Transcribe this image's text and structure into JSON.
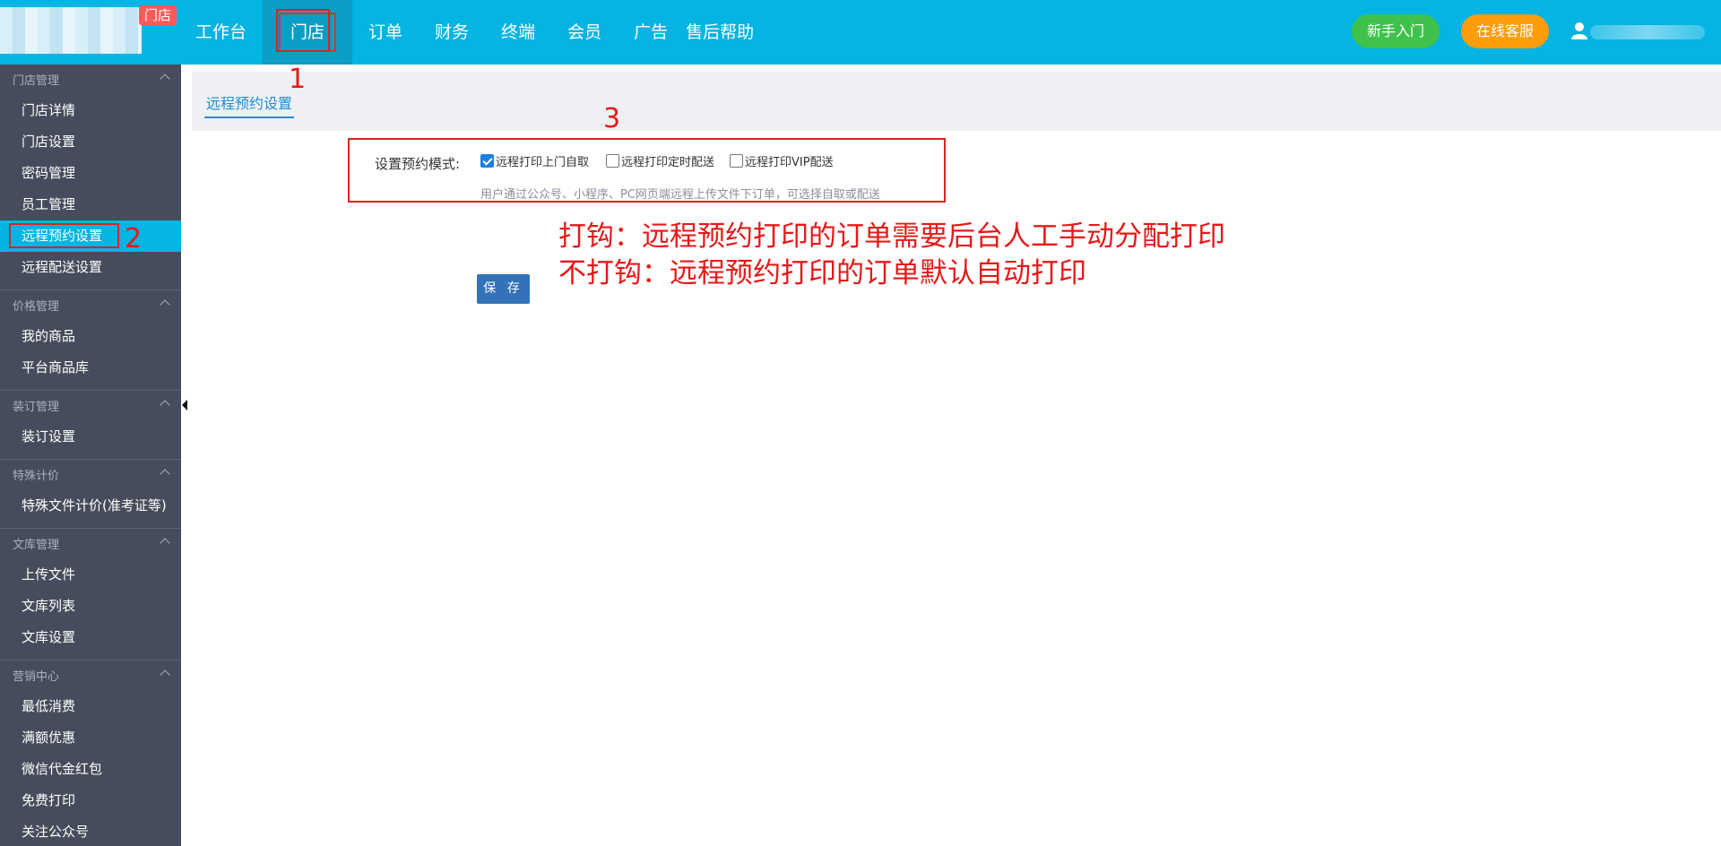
{
  "header": {
    "logo_badge": "门店",
    "nav": [
      "工作台",
      "门店",
      "订单",
      "财务",
      "终端",
      "会员",
      "广告",
      "售后帮助"
    ],
    "active_nav_index": 1,
    "new_user_button": "新手入门",
    "service_button": "在线客服",
    "user_icon": "user-icon"
  },
  "sidebar": {
    "groups": [
      {
        "title": "门店管理",
        "items": [
          "门店详情",
          "门店设置",
          "密码管理",
          "员工管理",
          "远程预约设置",
          "远程配送设置"
        ]
      },
      {
        "title": "价格管理",
        "items": [
          "我的商品",
          "平台商品库"
        ]
      },
      {
        "title": "装订管理",
        "items": [
          "装订设置"
        ]
      },
      {
        "title": "特殊计价",
        "items": [
          "特殊文件计价(准考证等)"
        ]
      },
      {
        "title": "文库管理",
        "items": [
          "上传文件",
          "文库列表",
          "文库设置"
        ]
      },
      {
        "title": "营销中心",
        "items": [
          "最低消费",
          "满额优惠",
          "微信代金红包",
          "免费打印",
          "关注公众号"
        ]
      }
    ],
    "active_item": "远程预约设置"
  },
  "main": {
    "tab": "远程预约设置",
    "form_label": "设置预约模式:",
    "options": [
      {
        "label": "远程打印上门自取",
        "checked": true
      },
      {
        "label": "远程打印定时配送",
        "checked": false
      },
      {
        "label": "远程打印VIP配送",
        "checked": false
      }
    ],
    "hint": "用户通过公众号、小程序、PC网页端远程上传文件下订单，可选择自取或配送",
    "save_button": "保 存"
  },
  "annotations": {
    "num1": "1",
    "num2": "2",
    "num3": "3",
    "line1": "打钩：远程预约打印的订单需要后台人工手动分配打印",
    "line2": "不打钩：远程预约打印的订单默认自动打印",
    "color": "#e51919"
  }
}
